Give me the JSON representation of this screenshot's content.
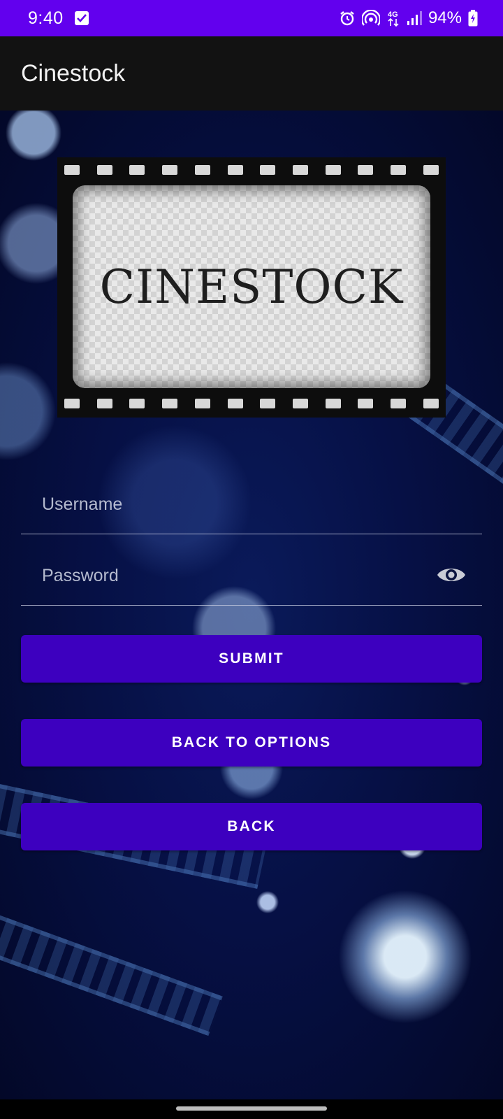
{
  "status_bar": {
    "time": "9:40",
    "battery_percent": "94%",
    "icons": [
      "checkbox-icon",
      "alarm-icon",
      "hotspot-icon",
      "4g-icon",
      "signal-icon",
      "battery-charging-icon"
    ],
    "network_label": "4G",
    "background_color": "#6200EE"
  },
  "app_bar": {
    "title": "Cinestock"
  },
  "logo": {
    "text": "CINESTOCK"
  },
  "form": {
    "username_placeholder": "Username",
    "username_value": "",
    "password_placeholder": "Password",
    "password_value": "",
    "password_toggle_icon": "eye-icon"
  },
  "buttons": {
    "submit": "SUBMIT",
    "back_to_options": "BACK TO OPTIONS",
    "back": "BACK",
    "color": "#3D00BF"
  }
}
